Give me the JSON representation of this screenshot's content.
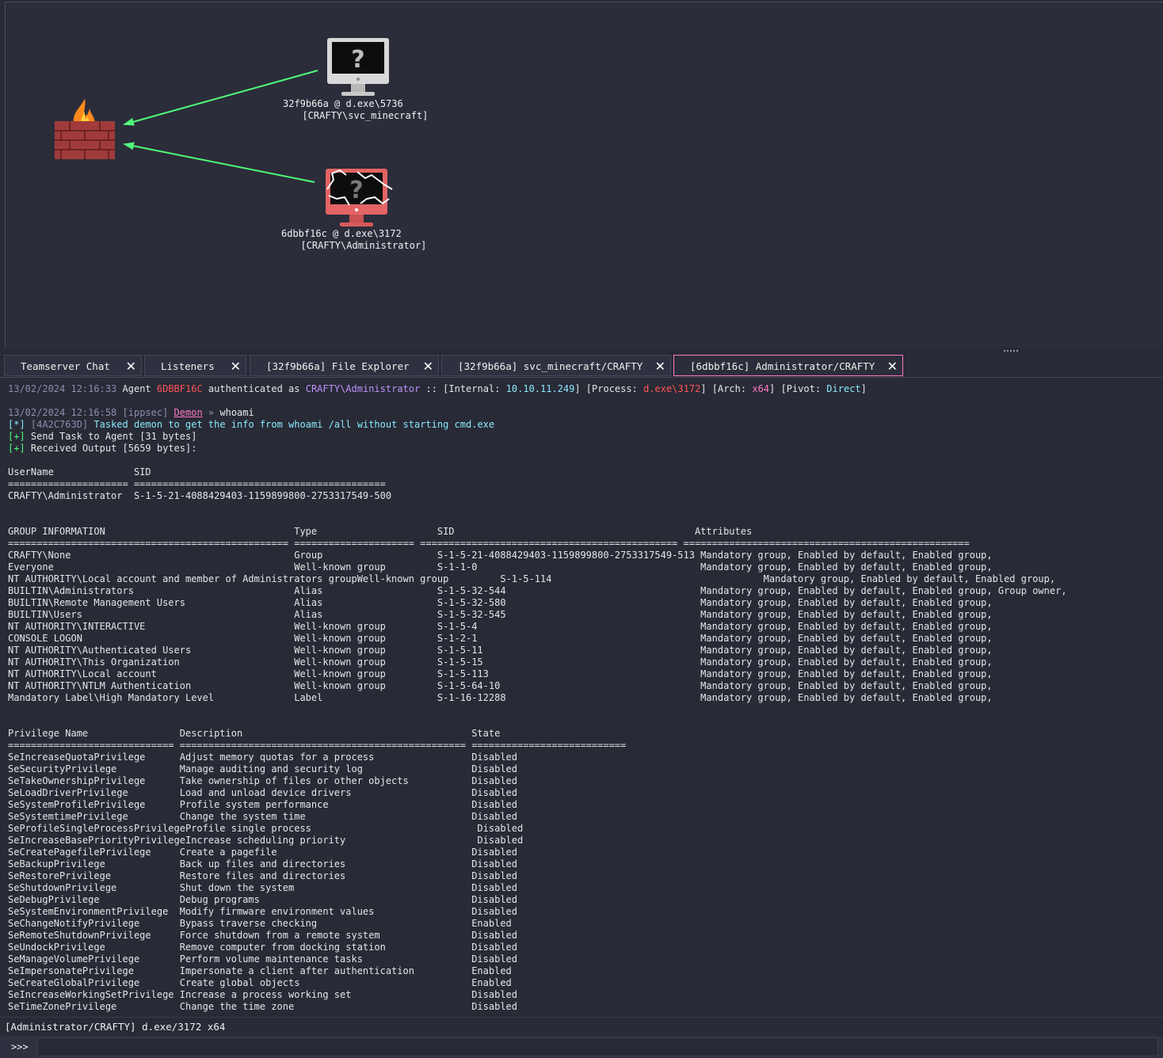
{
  "graph": {
    "nodes": [
      {
        "id": "teamserver",
        "icon": "firewall-icon"
      },
      {
        "id": "32f9b66a",
        "icon": "monitor-unknown-icon",
        "line1": "32f9b66a @ d.exe\\5736",
        "line2": "[CRAFTY\\svc_minecraft]"
      },
      {
        "id": "6dbbf16c",
        "icon": "monitor-elevated-icon",
        "line1": "6dbbf16c @ d.exe\\3172",
        "line2": "[CRAFTY\\Administrator]"
      }
    ],
    "link_color": "#50fa7b"
  },
  "tabs": [
    {
      "label": "Teamserver Chat"
    },
    {
      "label": "Listeners"
    },
    {
      "label": "[32f9b66a] File Explorer"
    },
    {
      "label": "[32f9b66a] svc_minecraft/CRAFTY"
    },
    {
      "label": "[6dbbf16c] Administrator/CRAFTY"
    }
  ],
  "console": {
    "auth": {
      "ts": "13/02/2024 12:16:33",
      "agent_word": "Agent",
      "agent": "6DBBF16C",
      "auth_word": "authenticated as",
      "user": "CRAFTY\\Administrator",
      "sep": "::",
      "internal_label": "[Internal:",
      "internal": "10.10.11.249",
      "process_label": "] [Process:",
      "process": "d.exe\\3172",
      "arch_label": "] [Arch:",
      "arch": "x64",
      "pivot_label": "] [Pivot:",
      "pivot": "Direct",
      "close": "]"
    },
    "cmd": {
      "ts": "13/02/2024 12:16:58",
      "operator": "[ippsec]",
      "demon": "Demon",
      "arrow": "»",
      "command": "whoami"
    },
    "tasked": {
      "tag": "[*]",
      "id": "[4A2C763D]",
      "text": "Tasked demon to get the info from whoami /all without starting cmd.exe"
    },
    "sent": {
      "tag": "[+]",
      "text": "Send Task to Agent [31 bytes]"
    },
    "received": {
      "tag": "[+]",
      "text": "Received Output [5659 bytes]:"
    },
    "output": "UserName              SID\n===================== ============================================\nCRAFTY\\Administrator  S-1-5-21-4088429403-1159899800-2753317549-500\n\n\nGROUP INFORMATION                                 Type                     SID                                          Attributes\n================================================= ===================== ============================================= ==================================================\nCRAFTY\\None                                       Group                    S-1-5-21-4088429403-1159899800-2753317549-513 Mandatory group, Enabled by default, Enabled group,\nEveryone                                          Well-known group         S-1-1-0                                       Mandatory group, Enabled by default, Enabled group,\nNT AUTHORITY\\Local account and member of Administrators groupWell-known group         S-1-5-114                                     Mandatory group, Enabled by default, Enabled group,\nBUILTIN\\Administrators                            Alias                    S-1-5-32-544                                  Mandatory group, Enabled by default, Enabled group, Group owner,\nBUILTIN\\Remote Management Users                   Alias                    S-1-5-32-580                                  Mandatory group, Enabled by default, Enabled group,\nBUILTIN\\Users                                     Alias                    S-1-5-32-545                                  Mandatory group, Enabled by default, Enabled group,\nNT AUTHORITY\\INTERACTIVE                          Well-known group         S-1-5-4                                       Mandatory group, Enabled by default, Enabled group,\nCONSOLE LOGON                                     Well-known group         S-1-2-1                                       Mandatory group, Enabled by default, Enabled group,\nNT AUTHORITY\\Authenticated Users                  Well-known group         S-1-5-11                                      Mandatory group, Enabled by default, Enabled group,\nNT AUTHORITY\\This Organization                    Well-known group         S-1-5-15                                      Mandatory group, Enabled by default, Enabled group,\nNT AUTHORITY\\Local account                        Well-known group         S-1-5-113                                     Mandatory group, Enabled by default, Enabled group,\nNT AUTHORITY\\NTLM Authentication                  Well-known group         S-1-5-64-10                                   Mandatory group, Enabled by default, Enabled group,\nMandatory Label\\High Mandatory Level              Label                    S-1-16-12288                                  Mandatory group, Enabled by default, Enabled group,\n\n\nPrivilege Name                Description                                        State\n============================= ================================================== ===========================\nSeIncreaseQuotaPrivilege      Adjust memory quotas for a process                 Disabled\nSeSecurityPrivilege           Manage auditing and security log                   Disabled\nSeTakeOwnershipPrivilege      Take ownership of files or other objects           Disabled\nSeLoadDriverPrivilege         Load and unload device drivers                     Disabled\nSeSystemProfilePrivilege      Profile system performance                         Disabled\nSeSystemtimePrivilege         Change the system time                             Disabled\nSeProfileSingleProcessPrivilegeProfile single process                             Disabled\nSeIncreaseBasePriorityPrivilegeIncrease scheduling priority                       Disabled\nSeCreatePagefilePrivilege     Create a pagefile                                  Disabled\nSeBackupPrivilege             Back up files and directories                      Disabled\nSeRestorePrivilege            Restore files and directories                      Disabled\nSeShutdownPrivilege           Shut down the system                               Disabled\nSeDebugPrivilege              Debug programs                                     Disabled\nSeSystemEnvironmentPrivilege  Modify firmware environment values                 Disabled\nSeChangeNotifyPrivilege       Bypass traverse checking                           Enabled\nSeRemoteShutdownPrivilege     Force shutdown from a remote system                Disabled\nSeUndockPrivilege             Remove computer from docking station               Disabled\nSeManageVolumePrivilege       Perform volume maintenance tasks                   Disabled\nSeImpersonatePrivilege        Impersonate a client after authentication          Enabled\nSeCreateGlobalPrivilege       Create global objects                              Enabled\nSeIncreaseWorkingSetPrivilege Increase a process working set                     Disabled\nSeTimeZonePrivilege           Change the time zone                               Disabled"
  },
  "status_bar": {
    "text": "[Administrator/CRAFTY] d.exe/3172 x64"
  },
  "input": {
    "prompt": ">>>",
    "value": ""
  },
  "colors": {
    "background": "#282a36",
    "accent_pink": "#ff79c6",
    "green": "#50fa7b",
    "red": "#ff5555",
    "purple": "#bd93f9",
    "cyan": "#8be9fd"
  }
}
